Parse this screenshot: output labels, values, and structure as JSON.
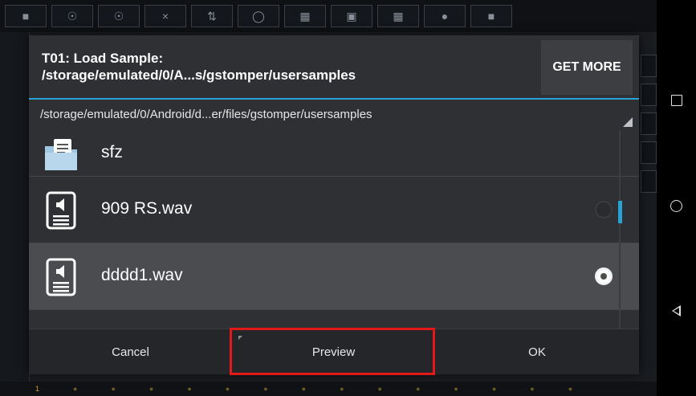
{
  "dialog": {
    "title_line1": "T01: Load Sample:",
    "title_line2": "/storage/emulated/0/A...s/gstomper/usersamples",
    "get_more_label": "GET MORE",
    "path": "/storage/emulated/0/Android/d...er/files/gstomper/usersamples",
    "items": [
      {
        "name": "sfz",
        "type": "folder",
        "selected": false
      },
      {
        "name": "909 RS.wav",
        "type": "audio-file",
        "selected": false
      },
      {
        "name": "dddd1.wav",
        "type": "audio-file",
        "selected": true
      }
    ],
    "buttons": {
      "cancel": "Cancel",
      "preview": "Preview",
      "ok": "OK"
    }
  },
  "background": {
    "bottom_numbers": [
      "1"
    ]
  },
  "colors": {
    "accent": "#2aa3d4",
    "dialog_bg": "#2f3033",
    "selected_row": "#4b4c50",
    "highlight_box": "#e31818"
  },
  "icons": {
    "nav_recent": "square-icon",
    "nav_home": "circle-icon",
    "nav_back": "back-triangle-icon",
    "folder": "folder-icon",
    "audio_file": "audio-file-icon"
  }
}
